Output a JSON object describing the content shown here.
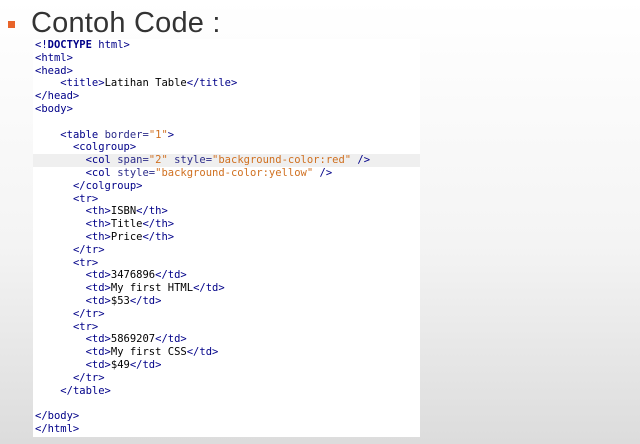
{
  "slide": {
    "title": "Contoh Code :",
    "bullet_color": "#e8642a"
  },
  "code": {
    "lines": [
      [
        "<!",
        "DOCTYPE",
        " html>"
      ],
      [
        "<html>"
      ],
      [
        "<head>"
      ],
      [
        "    ",
        "<title>",
        "Latihan Table",
        "</title>"
      ],
      [
        "</head>"
      ],
      [
        "<body>"
      ],
      [
        ""
      ],
      [
        "    ",
        "<table ",
        "border=",
        "\"1\"",
        ">"
      ],
      [
        "      ",
        "<colgroup>"
      ],
      [
        "        ",
        "<col ",
        "span=",
        "\"2\"",
        " style=",
        "\"background-color:red\"",
        " />"
      ],
      [
        "        ",
        "<col ",
        "style=",
        "\"background-color:yellow\"",
        " />"
      ],
      [
        "      ",
        "</colgroup>"
      ],
      [
        "      ",
        "<tr>"
      ],
      [
        "        ",
        "<th>",
        "ISBN",
        "</th>"
      ],
      [
        "        ",
        "<th>",
        "Title",
        "</th>"
      ],
      [
        "        ",
        "<th>",
        "Price",
        "</th>"
      ],
      [
        "      ",
        "</tr>"
      ],
      [
        "      ",
        "<tr>"
      ],
      [
        "        ",
        "<td>",
        "3476896",
        "</td>"
      ],
      [
        "        ",
        "<td>",
        "My first HTML",
        "</td>"
      ],
      [
        "        ",
        "<td>",
        "$53",
        "</td>"
      ],
      [
        "      ",
        "</tr>"
      ],
      [
        "      ",
        "<tr>"
      ],
      [
        "        ",
        "<td>",
        "5869207",
        "</td>"
      ],
      [
        "        ",
        "<td>",
        "My first CSS",
        "</td>"
      ],
      [
        "        ",
        "<td>",
        "$49",
        "</td>"
      ],
      [
        "      ",
        "</tr>"
      ],
      [
        "    ",
        "</table>"
      ],
      [
        ""
      ],
      [
        "</body>"
      ],
      [
        "</html>"
      ]
    ]
  }
}
